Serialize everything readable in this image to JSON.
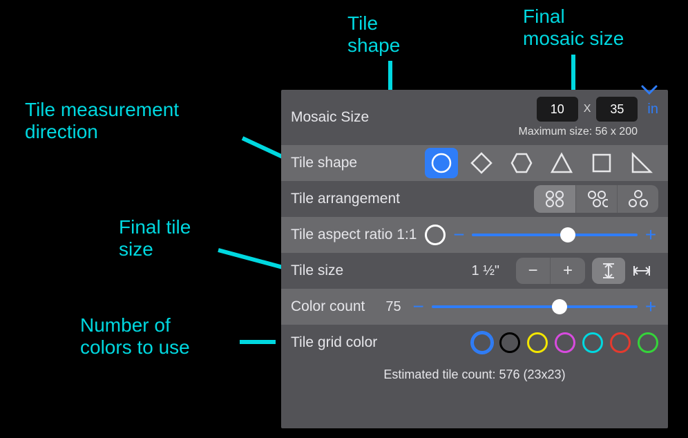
{
  "callouts": {
    "tile_shape": "Tile\nshape",
    "final_mosaic_size": "Final\nmosaic size",
    "tile_measure_dir": "Tile measurement\ndirection",
    "final_tile_size": "Final tile\nsize",
    "num_colors": "Number of\ncolors to use"
  },
  "mosaic": {
    "label": "Mosaic Size",
    "width": "10",
    "height": "35",
    "x": "X",
    "unit": "in",
    "max_label": "Maximum size: 56 x 200"
  },
  "tile_shape": {
    "label": "Tile shape",
    "options": [
      "circle",
      "diamond",
      "hexagon",
      "triangle",
      "square",
      "right-triangle"
    ],
    "selected": "circle"
  },
  "arrangement": {
    "label": "Tile arrangement",
    "options": [
      "grid",
      "offset",
      "hex"
    ],
    "selected": "grid"
  },
  "aspect": {
    "label": "Tile aspect ratio 1:1",
    "slider_percent": 58
  },
  "tile_size": {
    "label": "Tile size",
    "value": "1 ½\"",
    "direction_selected": "vertical"
  },
  "color_count": {
    "label": "Color count",
    "value": "75",
    "slider_percent": 62
  },
  "grid_color": {
    "label": "Tile grid color",
    "colors": [
      "#2f7df8",
      "#000000",
      "#f3e600",
      "#d84bdf",
      "#00d8e0",
      "#e53a2e",
      "#35d43a"
    ],
    "selected_index": 0
  },
  "estimate": "Estimated tile count: 576 (23x23)"
}
